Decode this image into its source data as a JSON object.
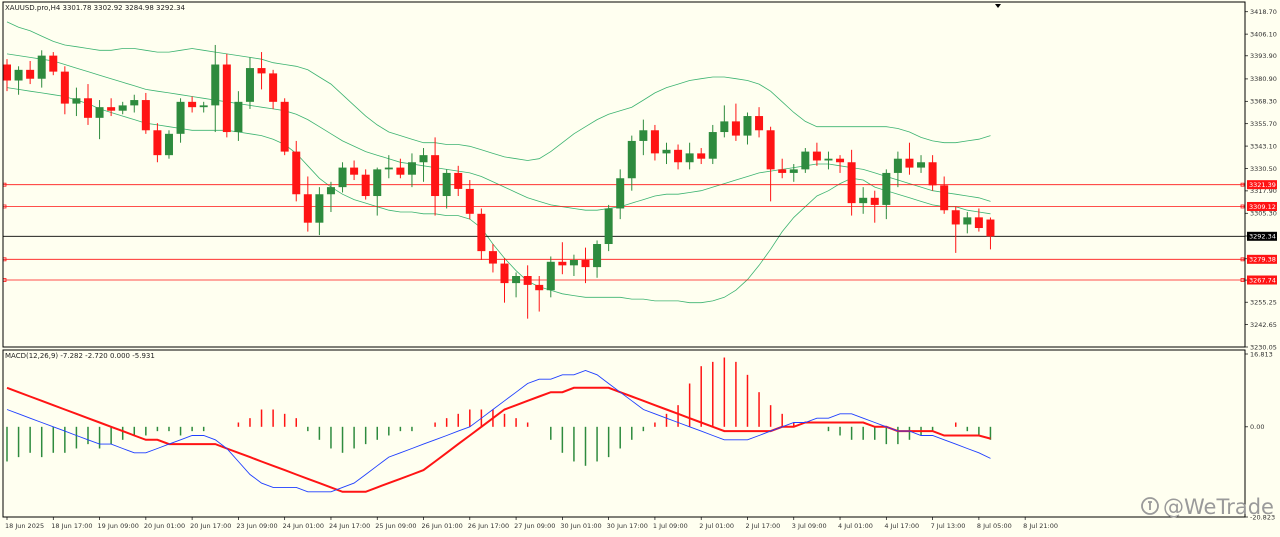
{
  "header": {
    "main_info": "XAUUSD.pro,H4  3301.78 3302.92 3284.98 3292.34",
    "macd_info": "MACD(12,26,9) -7.282 -2.720 0.000 -5.931"
  },
  "watermark": {
    "text": "@WeTrade",
    "icon": "wetrade-logo-icon"
  },
  "colors": {
    "background": "#fffff0",
    "bull": "#2e8b3e",
    "bear": "#ff1414",
    "bollinger": "#3cb371",
    "hline": "#ff1414",
    "current_line": "#000000",
    "macd_hist_pos": "#ff1414",
    "macd_hist_neg": "#2e8b3e",
    "macd_line": "#1f3fff",
    "signal_line": "#ff1414"
  },
  "chart_data": [
    {
      "type": "candlestick",
      "symbol": "XAUUSD.pro",
      "timeframe": "H4",
      "ylim": [
        3230.05,
        3423.05
      ],
      "y_ticks": [
        "3418.70",
        "3406.10",
        "3393.90",
        "3380.90",
        "3368.30",
        "3355.70",
        "3343.10",
        "3330.50",
        "3317.90",
        "3305.30",
        "3292.50",
        "3279.70",
        "3267.70",
        "3255.25",
        "3242.65",
        "3230.05"
      ],
      "x_tick_labels": [
        "18 Jun 2025",
        "18 Jun 17:00",
        "19 Jun 09:00",
        "20 Jun 01:00",
        "20 Jun 17:00",
        "23 Jun 09:00",
        "24 Jun 01:00",
        "24 Jun 17:00",
        "25 Jun 09:00",
        "26 Jun 01:00",
        "26 Jun 17:00",
        "27 Jun 09:00",
        "30 Jun 01:00",
        "30 Jun 17:00",
        "1 Jul 09:00",
        "2 Jul 01:00",
        "2 Jul 17:00",
        "3 Jul 09:00",
        "4 Jul 01:00",
        "4 Jul 17:00",
        "7 Jul 13:00",
        "8 Jul 05:00",
        "8 Jul 21:00"
      ],
      "horizontal_lines": [
        {
          "value": 3321.39,
          "label": "3321.39"
        },
        {
          "value": 3309.12,
          "label": "3309.12"
        },
        {
          "value": 3279.38,
          "label": "3279.38"
        },
        {
          "value": 3267.74,
          "label": "3267.74"
        }
      ],
      "current_price": {
        "value": 3292.34,
        "label": "3292.34"
      },
      "ohlc": [
        [
          3389,
          3392,
          3374,
          3380
        ],
        [
          3380,
          3388,
          3372,
          3386
        ],
        [
          3386,
          3391,
          3378,
          3381
        ],
        [
          3381,
          3397,
          3376,
          3394
        ],
        [
          3394,
          3396,
          3383,
          3385
        ],
        [
          3385,
          3388,
          3361,
          3367
        ],
        [
          3367,
          3376,
          3360,
          3370
        ],
        [
          3370,
          3378,
          3355,
          3359
        ],
        [
          3359,
          3369,
          3347,
          3365
        ],
        [
          3365,
          3370,
          3360,
          3363
        ],
        [
          3363,
          3368,
          3361,
          3366
        ],
        [
          3366,
          3372,
          3362,
          3369
        ],
        [
          3369,
          3373,
          3350,
          3352
        ],
        [
          3352,
          3356,
          3334,
          3338
        ],
        [
          3338,
          3352,
          3336,
          3350
        ],
        [
          3350,
          3370,
          3345,
          3368
        ],
        [
          3368,
          3371,
          3362,
          3365
        ],
        [
          3365,
          3368,
          3362,
          3366
        ],
        [
          3366,
          3400,
          3351,
          3389
        ],
        [
          3389,
          3395,
          3348,
          3351
        ],
        [
          3351,
          3374,
          3346,
          3368
        ],
        [
          3368,
          3393,
          3364,
          3387
        ],
        [
          3387,
          3396,
          3375,
          3384
        ],
        [
          3384,
          3386,
          3364,
          3368
        ],
        [
          3368,
          3370,
          3338,
          3340
        ],
        [
          3340,
          3346,
          3312,
          3316
        ],
        [
          3316,
          3326,
          3295,
          3300
        ],
        [
          3300,
          3320,
          3293,
          3316
        ],
        [
          3316,
          3323,
          3306,
          3320
        ],
        [
          3320,
          3334,
          3317,
          3331
        ],
        [
          3331,
          3335,
          3324,
          3327
        ],
        [
          3327,
          3330,
          3313,
          3315
        ],
        [
          3315,
          3331,
          3304,
          3330
        ],
        [
          3330,
          3338,
          3325,
          3331
        ],
        [
          3331,
          3336,
          3325,
          3327
        ],
        [
          3327,
          3339,
          3320,
          3334
        ],
        [
          3334,
          3342,
          3323,
          3338
        ],
        [
          3338,
          3348,
          3304,
          3315
        ],
        [
          3315,
          3330,
          3308,
          3328
        ],
        [
          3328,
          3332,
          3315,
          3319
        ],
        [
          3319,
          3324,
          3302,
          3305
        ],
        [
          3305,
          3308,
          3279,
          3284
        ],
        [
          3284,
          3288,
          3272,
          3277
        ],
        [
          3277,
          3280,
          3255,
          3266
        ],
        [
          3266,
          3272,
          3258,
          3270
        ],
        [
          3270,
          3276,
          3246,
          3265
        ],
        [
          3265,
          3270,
          3250,
          3262
        ],
        [
          3262,
          3281,
          3258,
          3278
        ],
        [
          3278,
          3289,
          3271,
          3276
        ],
        [
          3276,
          3282,
          3270,
          3279
        ],
        [
          3279,
          3286,
          3266,
          3275
        ],
        [
          3275,
          3290,
          3269,
          3288
        ],
        [
          3288,
          3310,
          3284,
          3308
        ],
        [
          3308,
          3330,
          3302,
          3325
        ],
        [
          3325,
          3349,
          3318,
          3346
        ],
        [
          3346,
          3358,
          3338,
          3352
        ],
        [
          3352,
          3355,
          3335,
          3339
        ],
        [
          3339,
          3345,
          3333,
          3341
        ],
        [
          3341,
          3344,
          3330,
          3334
        ],
        [
          3334,
          3345,
          3330,
          3339
        ],
        [
          3339,
          3342,
          3333,
          3336
        ],
        [
          3336,
          3355,
          3333,
          3351
        ],
        [
          3351,
          3366,
          3348,
          3357
        ],
        [
          3357,
          3367,
          3346,
          3349
        ],
        [
          3349,
          3362,
          3344,
          3360
        ],
        [
          3360,
          3365,
          3348,
          3352
        ],
        [
          3352,
          3354,
          3312,
          3330
        ],
        [
          3330,
          3336,
          3325,
          3328
        ],
        [
          3328,
          3333,
          3323,
          3330
        ],
        [
          3330,
          3342,
          3328,
          3340
        ],
        [
          3340,
          3345,
          3332,
          3335
        ],
        [
          3335,
          3340,
          3330,
          3336
        ],
        [
          3336,
          3338,
          3328,
          3334
        ],
        [
          3334,
          3341,
          3304,
          3311
        ],
        [
          3311,
          3320,
          3305,
          3314
        ],
        [
          3314,
          3318,
          3300,
          3310
        ],
        [
          3310,
          3330,
          3302,
          3328
        ],
        [
          3328,
          3340,
          3320,
          3336
        ],
        [
          3336,
          3345,
          3327,
          3331
        ],
        [
          3331,
          3338,
          3328,
          3334
        ],
        [
          3334,
          3338,
          3318,
          3321
        ],
        [
          3321,
          3326,
          3305,
          3307
        ],
        [
          3307,
          3309,
          3283,
          3299
        ],
        [
          3299,
          3306,
          3294,
          3303
        ],
        [
          3303,
          3308,
          3295,
          3297
        ],
        [
          3301.78,
          3302.92,
          3284.98,
          3292.34
        ]
      ],
      "bollinger": {
        "upper": [
          3413,
          3410,
          3408,
          3405,
          3402,
          3400,
          3399,
          3398,
          3397,
          3397,
          3398,
          3398,
          3397,
          3396,
          3396,
          3397,
          3398,
          3397,
          3396,
          3395,
          3394,
          3393,
          3392,
          3390,
          3389,
          3388,
          3386,
          3382,
          3378,
          3372,
          3366,
          3360,
          3355,
          3351,
          3349,
          3347,
          3345,
          3345,
          3344,
          3344,
          3343,
          3341,
          3339,
          3337,
          3336,
          3335,
          3336,
          3340,
          3345,
          3350,
          3354,
          3358,
          3361,
          3363,
          3365,
          3369,
          3373,
          3376,
          3378,
          3380,
          3381,
          3382,
          3382,
          3381,
          3380,
          3378,
          3374,
          3368,
          3362,
          3357,
          3354,
          3354,
          3354,
          3354,
          3354,
          3354,
          3354,
          3353,
          3351,
          3348,
          3346,
          3345,
          3345,
          3346,
          3347,
          3349
        ],
        "middle": [
          3395,
          3394,
          3393,
          3392,
          3391,
          3389,
          3387,
          3385,
          3383,
          3381,
          3379,
          3377,
          3375,
          3374,
          3373,
          3372,
          3371,
          3370,
          3369,
          3368,
          3367,
          3366,
          3365,
          3364,
          3363,
          3361,
          3358,
          3354,
          3350,
          3346,
          3343,
          3340,
          3338,
          3336,
          3334,
          3333,
          3332,
          3331,
          3330,
          3329,
          3328,
          3326,
          3323,
          3320,
          3317,
          3314,
          3312,
          3310,
          3309,
          3308,
          3307,
          3307,
          3308,
          3309,
          3311,
          3313,
          3315,
          3316,
          3316,
          3317,
          3318,
          3320,
          3322,
          3324,
          3326,
          3328,
          3329,
          3330,
          3331,
          3332,
          3333,
          3333,
          3332,
          3331,
          3330,
          3328,
          3326,
          3324,
          3322,
          3320,
          3318,
          3317,
          3316,
          3315,
          3314,
          3312
        ],
        "lower": [
          3376,
          3375,
          3374,
          3373,
          3372,
          3371,
          3369,
          3367,
          3364,
          3362,
          3360,
          3358,
          3356,
          3355,
          3354,
          3353,
          3352,
          3352,
          3352,
          3352,
          3351,
          3350,
          3349,
          3347,
          3344,
          3339,
          3332,
          3325,
          3320,
          3316,
          3313,
          3311,
          3309,
          3307,
          3306,
          3306,
          3305,
          3305,
          3304,
          3304,
          3302,
          3297,
          3288,
          3280,
          3273,
          3267,
          3264,
          3262,
          3260,
          3259,
          3258,
          3258,
          3258,
          3258,
          3257,
          3257,
          3256,
          3256,
          3256,
          3255,
          3255,
          3256,
          3258,
          3262,
          3268,
          3276,
          3285,
          3295,
          3303,
          3309,
          3315,
          3318,
          3322,
          3325,
          3324,
          3320,
          3318,
          3316,
          3314,
          3312,
          3310,
          3309,
          3309,
          3307,
          3306,
          3305
        ]
      }
    },
    {
      "type": "macd",
      "params": "12,26,9",
      "ylim": [
        -20.823,
        16.813
      ],
      "y_ticks": [
        "16.813",
        "0.00",
        "-20.823"
      ],
      "histogram": [
        -8,
        -7,
        -6,
        -7,
        -6,
        -6,
        -5,
        -4,
        -5,
        -4,
        -3,
        -2,
        -2,
        -1,
        -1,
        -2,
        -1,
        -1,
        0,
        0,
        1,
        2,
        4,
        4,
        3,
        2,
        -1,
        -3,
        -5,
        -6,
        -5,
        -4,
        -3,
        -2,
        -1,
        -1,
        0,
        1,
        2,
        3,
        4,
        4,
        4,
        3,
        2,
        1,
        0,
        -3,
        -6,
        -8,
        -9,
        -8,
        -7,
        -5,
        -3,
        -1,
        1,
        3,
        5,
        10,
        14,
        15,
        16,
        15,
        12,
        8,
        5,
        3,
        1,
        0,
        0,
        -1,
        -2,
        -3,
        -3,
        -3,
        -4,
        -4,
        -3,
        -2,
        -1,
        0,
        1,
        -1,
        -2,
        -3
      ],
      "macd_line": [
        4,
        3,
        2,
        1,
        0,
        -1,
        -2,
        -3,
        -4,
        -4,
        -5,
        -6,
        -6,
        -5,
        -4,
        -3,
        -2,
        -2,
        -3,
        -5,
        -8,
        -11,
        -13,
        -14,
        -14,
        -14,
        -15,
        -15,
        -15,
        -14,
        -13,
        -11,
        -9,
        -7,
        -6,
        -5,
        -4,
        -3,
        -2,
        -1,
        0,
        2,
        4,
        6,
        8,
        10,
        11,
        11,
        12,
        12,
        13,
        12,
        10,
        8,
        6,
        4,
        3,
        2,
        1,
        0,
        -1,
        -2,
        -3,
        -3,
        -3,
        -2,
        -1,
        0,
        1,
        1,
        2,
        2,
        3,
        3,
        2,
        1,
        0,
        -1,
        -1,
        -2,
        -2,
        -3,
        -4,
        -5,
        -6,
        -7.282
      ],
      "signal_line": [
        9,
        8,
        7,
        6,
        5,
        4,
        3,
        2,
        1,
        0,
        -1,
        -2,
        -3,
        -3,
        -4,
        -4,
        -4,
        -4,
        -4,
        -5,
        -6,
        -7,
        -8,
        -9,
        -10,
        -11,
        -12,
        -13,
        -14,
        -15,
        -15,
        -15,
        -14,
        -13,
        -12,
        -11,
        -10,
        -8,
        -6,
        -4,
        -2,
        0,
        2,
        4,
        5,
        6,
        7,
        8,
        8,
        9,
        9,
        9,
        9,
        8,
        7,
        6,
        5,
        4,
        3,
        2,
        1,
        0,
        -1,
        -1,
        -1,
        -1,
        -1,
        0,
        0,
        1,
        1,
        1,
        1,
        1,
        1,
        0,
        0,
        -1,
        -1,
        -1,
        -1,
        -2,
        -2,
        -2,
        -2,
        -2.72
      ]
    }
  ]
}
